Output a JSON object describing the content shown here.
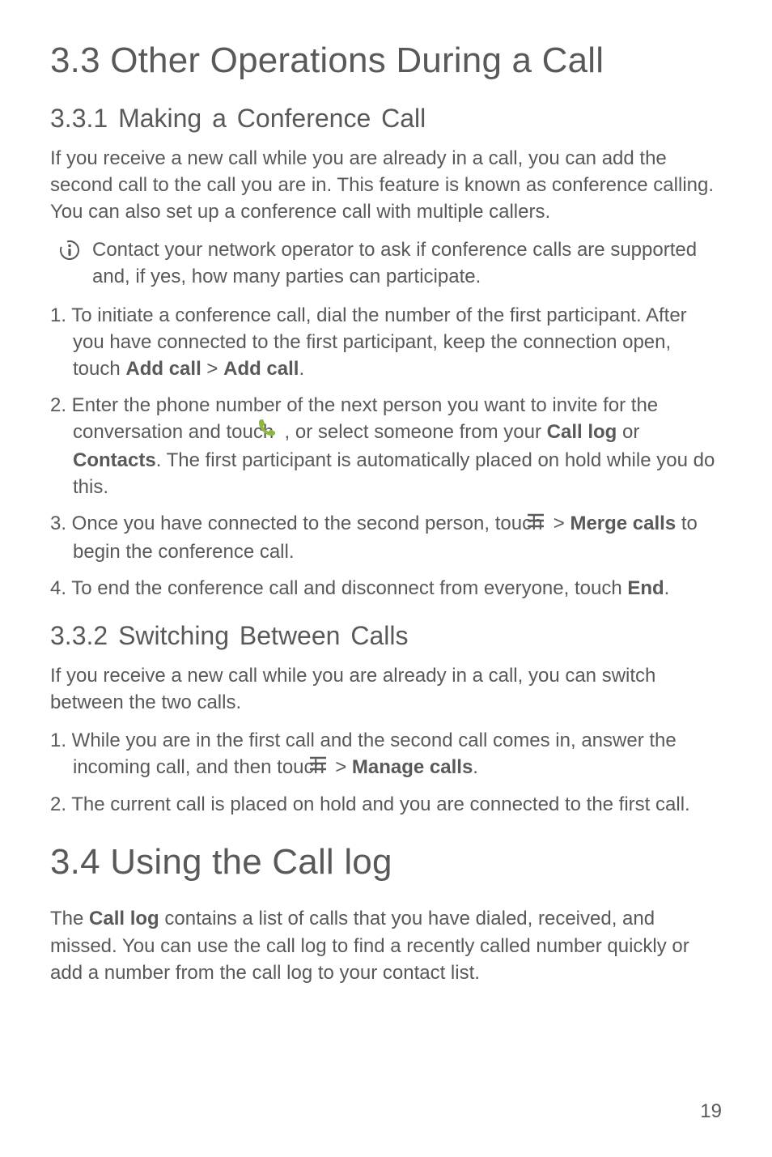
{
  "sec33": {
    "heading": "3.3  Other Operations During a Call"
  },
  "sec331": {
    "heading": "3.3.1  Making a Conference Call",
    "intro": "If you receive a new call while you are already in a call, you can add the second call to the call you are in. This feature is known as conference calling. You can also set up a conference call with multiple callers.",
    "note": "Contact your network operator to ask if conference calls are supported and, if yes, how many parties can participate.",
    "step1_a": "1. To initiate a conference call, dial the number of the first participant. After you have connected to the first participant, keep the connection open, touch ",
    "step1_b1": "Add call",
    "step1_gt": " > ",
    "step1_b2": "Add call",
    "step1_c": ".",
    "step2_a": "2. Enter the phone number of the next person you want to invite for the conversation and touch ",
    "step2_b": " , or select someone from your ",
    "step2_b1": "Call log",
    "step2_c": " or ",
    "step2_b2": "Contacts",
    "step2_d": ". The first participant is automatically placed on hold while you do this.",
    "step3_a": "3. Once you have connected to the second person, touch ",
    "step3_gt": "  > ",
    "step3_b1": "Merge calls",
    "step3_b": " to begin the conference call.",
    "step4_a": "4. To end the conference call and disconnect from everyone, touch ",
    "step4_b1": "End",
    "step4_b": "."
  },
  "sec332": {
    "heading": "3.3.2  Switching Between Calls",
    "intro": "If you receive a new call while you are already in a call, you can switch between the two calls.",
    "step1_a": "1. While you are in the first call and the second call comes in, answer the incoming call, and then touch ",
    "step1_gt": "  > ",
    "step1_b1": "Manage calls",
    "step1_b": ".",
    "step2": "2. The current call is placed on hold and you are connected to the first call."
  },
  "sec34": {
    "heading": "3.4  Using the Call log",
    "intro_a": "The ",
    "intro_b1": "Call log",
    "intro_b": " contains a list of calls that you have dialed, received, and missed. You can use the call log to find a recently called number quickly or add a number from the call log to your contact list."
  },
  "pageNumber": "19"
}
